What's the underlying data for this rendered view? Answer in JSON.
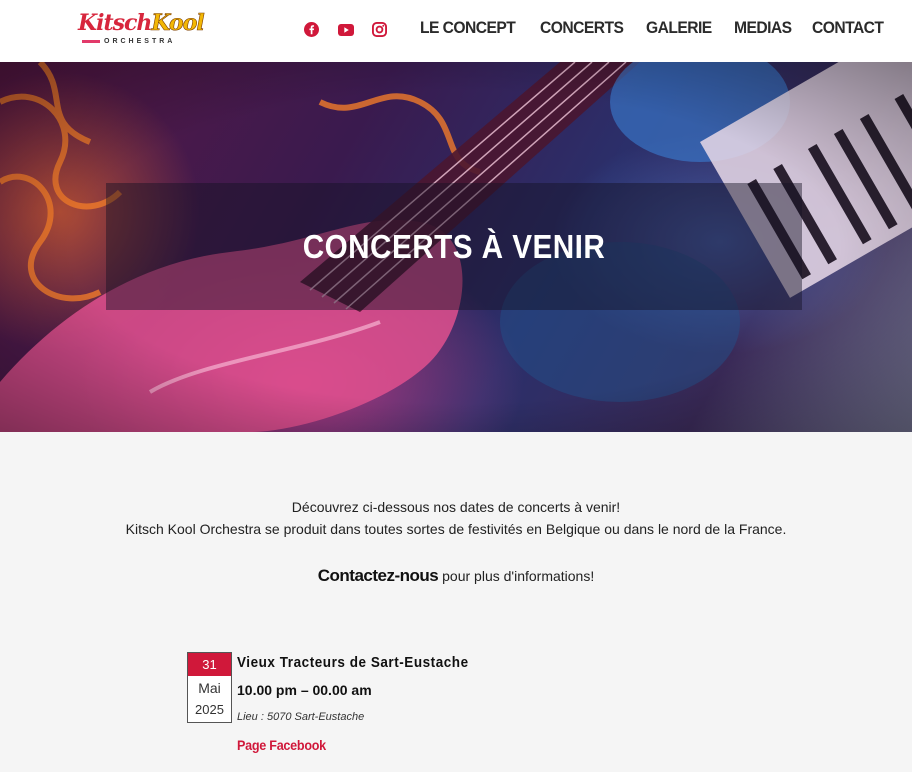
{
  "header": {
    "logo_primary_1": "Kitsch",
    "logo_primary_2": "Kool",
    "logo_secondary": "ORCHESTRA",
    "socials": [
      {
        "icon": "facebook-icon",
        "color": "#d0183a"
      },
      {
        "icon": "youtube-icon",
        "color": "#d0183a"
      },
      {
        "icon": "instagram-icon",
        "color": "#d0183a"
      }
    ],
    "nav": [
      {
        "label": "LE CONCEPT"
      },
      {
        "label": "CONCERTS",
        "active": true
      },
      {
        "label": "GALERIE"
      },
      {
        "label": "MEDIAS"
      },
      {
        "label": "CONTACT"
      }
    ]
  },
  "hero": {
    "title": "CONCERTS À VENIR"
  },
  "intro": {
    "line1": "Découvrez ci-dessous nos dates de concerts à venir!",
    "line2": "Kitsch Kool Orchestra se produit dans toutes sortes de festivités en Belgique ou dans le nord de la France.",
    "contact_link": "Contactez-nous",
    "contact_rest": " pour plus d'informations!"
  },
  "events": [
    {
      "day": "31",
      "month": "Mai",
      "year": "2025",
      "title": "Vieux Tracteurs de Sart-Eustache",
      "time": "10.00 pm – 00.00 am",
      "place": "Lieu : 5070 Sart-Eustache",
      "link_label": "Page Facebook"
    }
  ],
  "colors": {
    "accent": "#d0183a",
    "nav_text": "#2b2b2b",
    "page_bg": "#f5f5f5"
  }
}
